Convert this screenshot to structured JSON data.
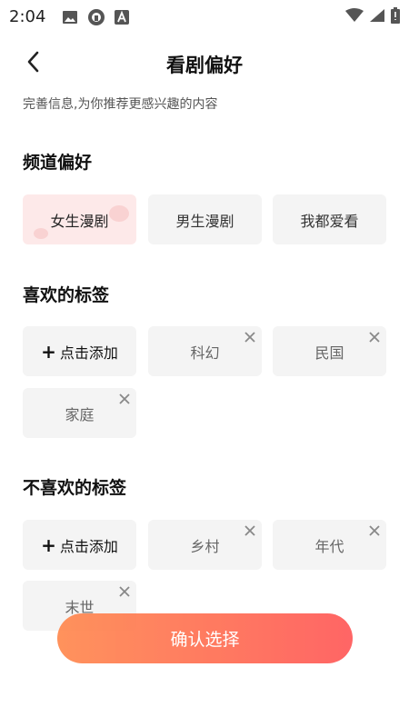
{
  "status_bar": {
    "time": "2:04"
  },
  "header": {
    "title": "看剧偏好"
  },
  "subtitle": "完善信息,为你推荐更感兴趣的内容",
  "channel": {
    "title": "频道偏好",
    "options": [
      "女生漫剧",
      "男生漫剧",
      "我都爱看"
    ],
    "selected": "女生漫剧"
  },
  "liked": {
    "title": "喜欢的标签",
    "add_label": "点击添加",
    "tags": [
      "科幻",
      "民国",
      "家庭"
    ]
  },
  "disliked": {
    "title": "不喜欢的标签",
    "add_label": "点击添加",
    "tags": [
      "乡村",
      "年代",
      "末世"
    ]
  },
  "confirm_label": "确认选择",
  "colors": {
    "selected_chip_bg": "#fde9e9",
    "chip_bg": "#f4f4f4",
    "button_gradient_start": "#ff8a50",
    "button_gradient_end": "#ff5a5a"
  }
}
